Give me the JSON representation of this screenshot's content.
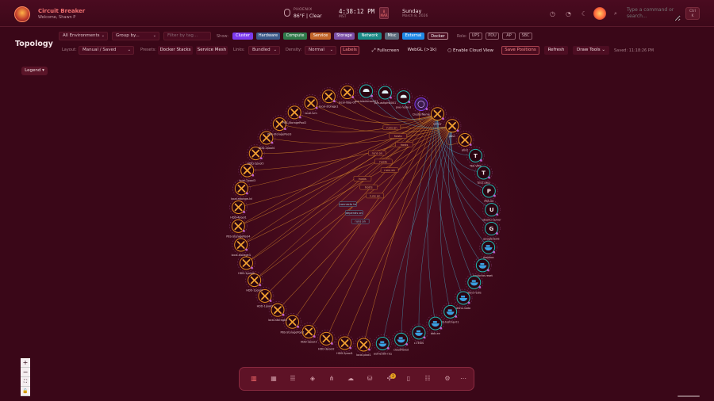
{
  "app": {
    "title": "Circuit Breaker",
    "welcome": "Welcome, Shawn P"
  },
  "weather": {
    "city": "PHOENIX",
    "temp": "86°F | Clear"
  },
  "clock": {
    "time": "4:38:12 PM",
    "tz": "MST"
  },
  "calendar": {
    "day_num": "8",
    "month_abbr": "MAR",
    "day_name": "Sunday",
    "date": "March 8, 2026"
  },
  "command": {
    "placeholder": "Type a command or search...",
    "kbd_line1": "Ctrl",
    "kbd_line2": "K"
  },
  "page": {
    "title": "Topology"
  },
  "toolbar1": {
    "environment": "All Environments",
    "group_by": "Group by...",
    "tag_placeholder": "Filter by tag...",
    "show_label": "Show:",
    "show_chips": [
      {
        "label": "Cluster",
        "color": "#7c3aed"
      },
      {
        "label": "Hardware",
        "color": "#3b5a8a"
      },
      {
        "label": "Compute",
        "color": "#2f7a4a"
      },
      {
        "label": "Service",
        "color": "#c2652a"
      },
      {
        "label": "Storage",
        "color": "#7a4ea6"
      },
      {
        "label": "Network",
        "color": "#1a8a86"
      },
      {
        "label": "Misc",
        "color": "#5a6a7a"
      },
      {
        "label": "External",
        "color": "#1e88e5"
      },
      {
        "label": "Docker",
        "color": "#4a0b20"
      }
    ],
    "role_label": "Role:",
    "roles": [
      "UPS",
      "PDU",
      "AP",
      "SBC"
    ]
  },
  "toolbar2": {
    "layout_label": "Layout:",
    "layout_value": "Manual / Saved",
    "presets_label": "Presets:",
    "presets": [
      "Docker Stacks",
      "Service Mesh"
    ],
    "links_label": "Links:",
    "links_value": "Bundled",
    "density_label": "Density:",
    "density_value": "Normal",
    "labels_btn": "Labels",
    "fullscreen_btn": "Fullscreen",
    "webgl_btn": "WebGL (>1k)",
    "cloud_view_btn": "Enable Cloud View",
    "save_btn": "Save Positions",
    "refresh_btn": "Refresh",
    "draw_tools_btn": "Draw Tools",
    "saved_text": "Saved: 11:18:26 PM"
  },
  "legend": {
    "label": "Legend"
  },
  "zoom": {
    "in": "+",
    "out": "−",
    "fit": "⛶",
    "lock": "🔒"
  },
  "colors": {
    "bg": "#3a0718",
    "accent": "#ff6060",
    "service": "#e08a1e",
    "cluster": "#7c3aed",
    "network": "#20b8b0",
    "docker": "#2f90d0",
    "edge_orange": "#d9892a",
    "edge_cyan": "#4aa9c8"
  },
  "nodes": [
    {
      "label": "local-ldap-01",
      "kind": "service"
    },
    {
      "label": "pve-blackmark01",
      "kind": "network"
    },
    {
      "label": "pve-ashpm8001",
      "kind": "network"
    },
    {
      "label": "pve-node-3",
      "kind": "network"
    },
    {
      "label": "ClusterName",
      "kind": "cluster"
    },
    {
      "label": "server",
      "kind": "service"
    },
    {
      "label": "pbs1",
      "kind": "service"
    },
    {
      "label": "pbs2",
      "kind": "service"
    },
    {
      "label": "T",
      "kind": "letter",
      "sub": "TEE-VMS"
    },
    {
      "label": "T",
      "kind": "letter",
      "sub": "TEST-VM1"
    },
    {
      "label": "P",
      "kind": "letter",
      "sub": "PBS-00"
    },
    {
      "label": "U",
      "kind": "letter",
      "sub": "ubuntu-server"
    },
    {
      "label": "G",
      "kind": "letter",
      "sub": "googlenews"
    },
    {
      "label": "dropbox",
      "kind": "docker"
    },
    {
      "label": "lancache-reset",
      "kind": "docker"
    },
    {
      "label": "ddns-redis",
      "kind": "docker"
    },
    {
      "label": "ddns-nodo",
      "kind": "docker"
    },
    {
      "label": "ib-testing-01",
      "kind": "docker"
    },
    {
      "label": "bbb-ee",
      "kind": "docker"
    },
    {
      "label": "c-TEKIS",
      "kind": "docker"
    },
    {
      "label": "cloudflared",
      "kind": "docker"
    },
    {
      "label": "authentik-rsq",
      "kind": "docker"
    },
    {
      "label": "local-pool1",
      "kind": "service"
    },
    {
      "label": "HDD-2pool1",
      "kind": "service"
    },
    {
      "label": "HDD-3pool2",
      "kind": "service"
    },
    {
      "label": "HDD-2pool3",
      "kind": "service"
    },
    {
      "label": "PBS-StoragePool1",
      "kind": "service"
    },
    {
      "label": "local-storage2",
      "kind": "service"
    },
    {
      "label": "HDD-1pool2",
      "kind": "service"
    },
    {
      "label": "HDD-1pool3",
      "kind": "service"
    },
    {
      "label": "HDD-1pool4",
      "kind": "service"
    },
    {
      "label": "local-storage3",
      "kind": "service"
    },
    {
      "label": "PBS-StoragePool4",
      "kind": "service"
    },
    {
      "label": "HDD-4pool1",
      "kind": "service"
    },
    {
      "label": "local-storage-lvl",
      "kind": "service"
    },
    {
      "label": "local-2pool3",
      "kind": "service"
    },
    {
      "label": "HDD-2pool5",
      "kind": "service"
    },
    {
      "label": "HDD-2pool4",
      "kind": "service"
    },
    {
      "label": "PBS-StoragePool3",
      "kind": "service"
    },
    {
      "label": "PBS-StoragePool2",
      "kind": "service"
    },
    {
      "label": "local-lvm",
      "kind": "service"
    },
    {
      "label": "local-storage1",
      "kind": "service"
    }
  ],
  "edge_labels": [
    "runs on",
    "hosts",
    "hosts",
    "runs on",
    "hosts",
    "runs on",
    "hosts",
    "hosts",
    "runs on",
    "connects to",
    "depends on",
    "runs on"
  ],
  "dock": {
    "badge": "2"
  }
}
